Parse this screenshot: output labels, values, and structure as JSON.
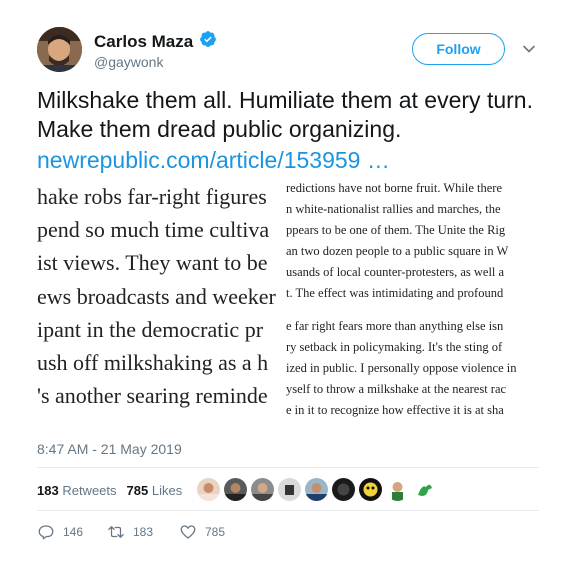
{
  "author": {
    "name": "Carlos Maza",
    "handle": "@gaywonk"
  },
  "follow_label": "Follow",
  "tweet": {
    "text": "Milkshake them all. Humiliate them at every turn. Make them dread public organizing.",
    "link": "newrepublic.com/article/153959 …"
  },
  "article_image": {
    "left_lines": [
      "hake robs far-right figures",
      "pend so much time cultiva",
      "ist views. They want to be",
      "ews broadcasts and weeker",
      "ipant in the democratic pr",
      "ush off milkshaking as a h",
      "'s another searing reminde"
    ],
    "right_lines": [
      "redictions have not borne fruit. While there",
      "n white-nationalist rallies and marches, the",
      "ppears to be one of them. The Unite the Rig",
      "an two dozen people to a public square in W",
      "usands of local counter-protesters, as well a",
      "t. The effect was intimidating and profound",
      "e far right fears more than anything else isn",
      "ry setback in policymaking. It's the sting of",
      "ized in public. I personally oppose violence in",
      "yself to throw a milkshake at the nearest rac",
      "e in it to recognize how effective it is at sha"
    ]
  },
  "timestamp": "8:47 AM - 21 May 2019",
  "stats": {
    "retweets_count": "183",
    "retweets_label": "Retweets",
    "likes_count": "785",
    "likes_label": "Likes"
  },
  "liker_avatars": [
    "avatar-1",
    "avatar-2",
    "avatar-3",
    "avatar-4",
    "avatar-5",
    "avatar-6",
    "avatar-7",
    "avatar-8",
    "avatar-9"
  ],
  "actions": {
    "replies": "146",
    "retweets": "183",
    "likes": "785"
  },
  "colors": {
    "accent": "#1da1f2",
    "link": "#1b95e0",
    "muted": "#657786"
  }
}
